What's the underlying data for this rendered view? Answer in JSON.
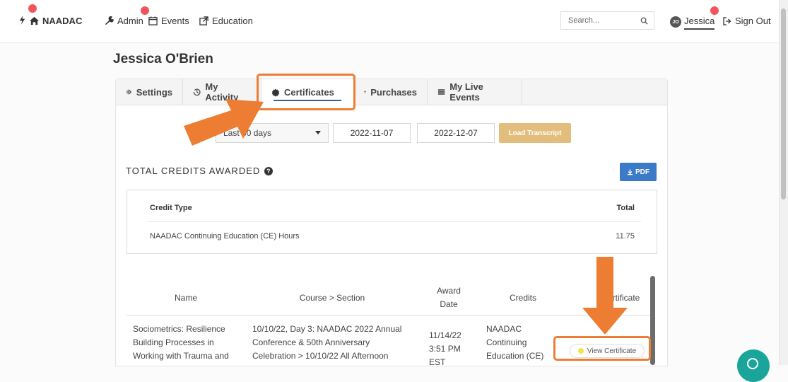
{
  "nav": {
    "brand": "NAADAC",
    "admin": "Admin",
    "events": "Events",
    "education": "Education",
    "search_placeholder": "Search...",
    "user_initials": "JO",
    "user_name": "Jessica",
    "sign_out": "Sign Out"
  },
  "page_title": "Jessica O'Brien",
  "tabs": [
    {
      "label": "Settings",
      "icon": "gear-icon"
    },
    {
      "label": "My Activity",
      "icon": "history-icon"
    },
    {
      "label": "Certificates",
      "icon": "certificate-icon",
      "active": true
    },
    {
      "label": "Purchases",
      "icon": "credit-card-icon"
    },
    {
      "label": "My Live Events",
      "icon": "list-icon"
    }
  ],
  "filters": {
    "range": "Last 30 days",
    "start_date": "2022-11-07",
    "end_date": "2022-12-07",
    "load_label": "Load Transcript"
  },
  "credits": {
    "title": "TOTAL CREDITS AWARDED",
    "pdf_label": "PDF",
    "col_type": "Credit Type",
    "col_total": "Total",
    "rows": [
      {
        "type": "NAADAC Continuing Education (CE) Hours",
        "total": "11.75"
      }
    ]
  },
  "certificates": {
    "headers": {
      "name": "Name",
      "course_section": "Course > Section",
      "award_date_1": "Award",
      "award_date_2": "Date",
      "credits": "Credits",
      "certificate": "rtificate"
    },
    "rows": [
      {
        "name_1": "Sociometrics: Resilience",
        "name_2": "Building Processes in",
        "name_3": "Working with Trauma and",
        "course_1": "10/10/22, Day 3: NAADAC 2022 Annual",
        "course_2": "Conference & 50th Anniversary",
        "course_3": "Celebration > 10/10/22 All Afternoon",
        "date_1": "11/14/22",
        "date_2": "3:51 PM",
        "date_3": "EST",
        "credits_1": "NAADAC",
        "credits_2": "Continuing",
        "credits_3": "Education (CE)",
        "action": "View Certificate"
      }
    ]
  },
  "colors": {
    "highlight": "#ec7d33",
    "pdf_button": "#3a7ac7",
    "load_button": "#e3bd7c",
    "notification_dot": "#f2545b",
    "chat_button": "#1aa59a"
  }
}
